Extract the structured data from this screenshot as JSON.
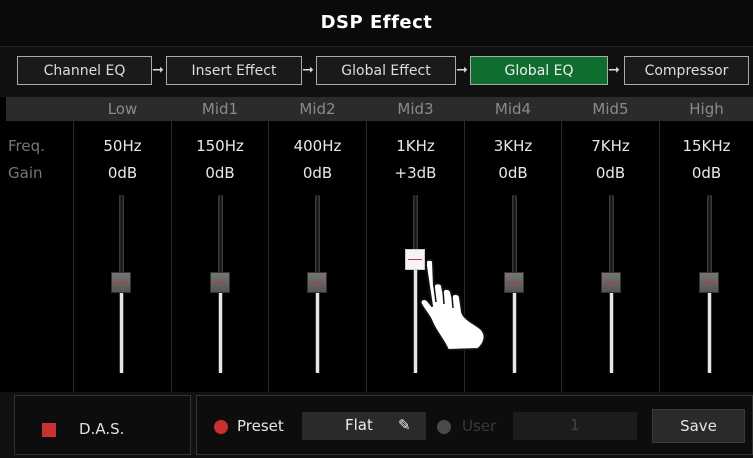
{
  "window": {
    "title": "DSP Effect"
  },
  "tabs": [
    {
      "label": "Channel EQ",
      "active": false
    },
    {
      "label": "Insert Effect",
      "active": false
    },
    {
      "label": "Global Effect",
      "active": false
    },
    {
      "label": "Global EQ",
      "active": true
    },
    {
      "label": "Compressor",
      "active": false
    }
  ],
  "row_labels": {
    "freq": "Freq.",
    "gain": "Gain"
  },
  "bands": [
    {
      "name": "Low",
      "freq": "50Hz",
      "gain": "0dB"
    },
    {
      "name": "Mid1",
      "freq": "150Hz",
      "gain": "0dB"
    },
    {
      "name": "Mid2",
      "freq": "400Hz",
      "gain": "0dB"
    },
    {
      "name": "Mid3",
      "freq": "1KHz",
      "gain": "+3dB",
      "active": true
    },
    {
      "name": "Mid4",
      "freq": "3KHz",
      "gain": "0dB"
    },
    {
      "name": "Mid5",
      "freq": "7KHz",
      "gain": "0dB"
    },
    {
      "name": "High",
      "freq": "15KHz",
      "gain": "0dB"
    }
  ],
  "das": {
    "label": "D.A.S.",
    "color": "#c83131"
  },
  "preset": {
    "label": "Preset",
    "value": "Flat",
    "selected": true,
    "color": "#c83131"
  },
  "user": {
    "label": "User",
    "value": "1",
    "selected": false
  },
  "save_label": "Save",
  "colors": {
    "active_tab": "#0f6e2f",
    "slider_mark": "#c0392b"
  }
}
